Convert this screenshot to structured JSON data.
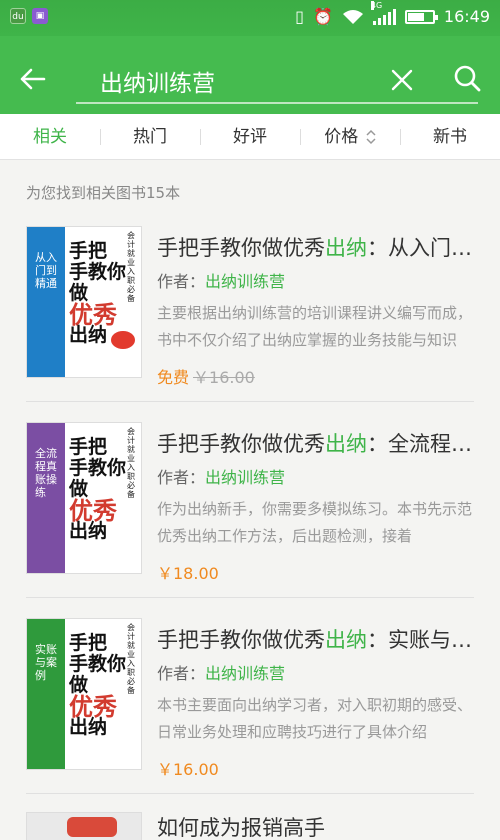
{
  "statusbar": {
    "time": "16:49",
    "network": "4G",
    "app_icon_1": "du",
    "app_icon_2": "gallery-icon"
  },
  "search": {
    "query": "出纳训练营",
    "placeholder": ""
  },
  "tabs": [
    {
      "label": "相关",
      "active": true
    },
    {
      "label": "热门",
      "active": false
    },
    {
      "label": "好评",
      "active": false
    },
    {
      "label": "价格",
      "active": false
    },
    {
      "label": "新书",
      "active": false
    }
  ],
  "result_count": "为您找到相关图书15本",
  "author_prefix": "作者：",
  "books": [
    {
      "title_pre": "手把手教你做优秀",
      "title_kw": "出纳",
      "title_post": "：从入门到精通",
      "author": "出纳训练营",
      "desc": "主要根据出纳训练营的培训课程讲义编写而成，书中不仅介绍了出纳应掌握的业务技能与知识",
      "free_label": "免费",
      "old_price": "￥16.00",
      "price": "",
      "cover": {
        "band_text": "从入门到精通",
        "big_1": "手把",
        "big_2": "手教你做",
        "hl": "优秀",
        "big_3": "出纳",
        "side": "会计就业入职必备"
      }
    },
    {
      "title_pre": "手把手教你做优秀",
      "title_kw": "出纳",
      "title_post": "：全流程真账操练",
      "author": "出纳训练营",
      "desc": "作为出纳新手，你需要多模拟练习。本书先示范优秀出纳工作方法，后出题检测，接着",
      "free_label": "",
      "old_price": "",
      "price": "￥18.00",
      "cover": {
        "band_text": "全流程真账操练",
        "big_1": "手把",
        "big_2": "手教你做",
        "hl": "优秀",
        "big_3": "出纳",
        "side": "会计就业入职必备"
      }
    },
    {
      "title_pre": "手把手教你做优秀",
      "title_kw": "出纳",
      "title_post": "：实账与案例",
      "author": "出纳训练营",
      "desc": "本书主要面向出纳学习者，对入职初期的感受、日常业务处理和应聘技巧进行了具体介绍",
      "free_label": "",
      "old_price": "",
      "price": "￥16.00",
      "cover": {
        "band_text": "实账与案例",
        "big_1": "手把",
        "big_2": "手教你做",
        "hl": "优秀",
        "big_3": "出纳",
        "side": "会计就业入职必备"
      }
    }
  ],
  "partial_book": {
    "title": "如何成为报销高手"
  },
  "colors": {
    "accent": "#3fb449",
    "price": "#f08a20",
    "band_1": "#1f7fc7",
    "band_2": "#7b4ea3",
    "band_3": "#2f9a3c"
  }
}
